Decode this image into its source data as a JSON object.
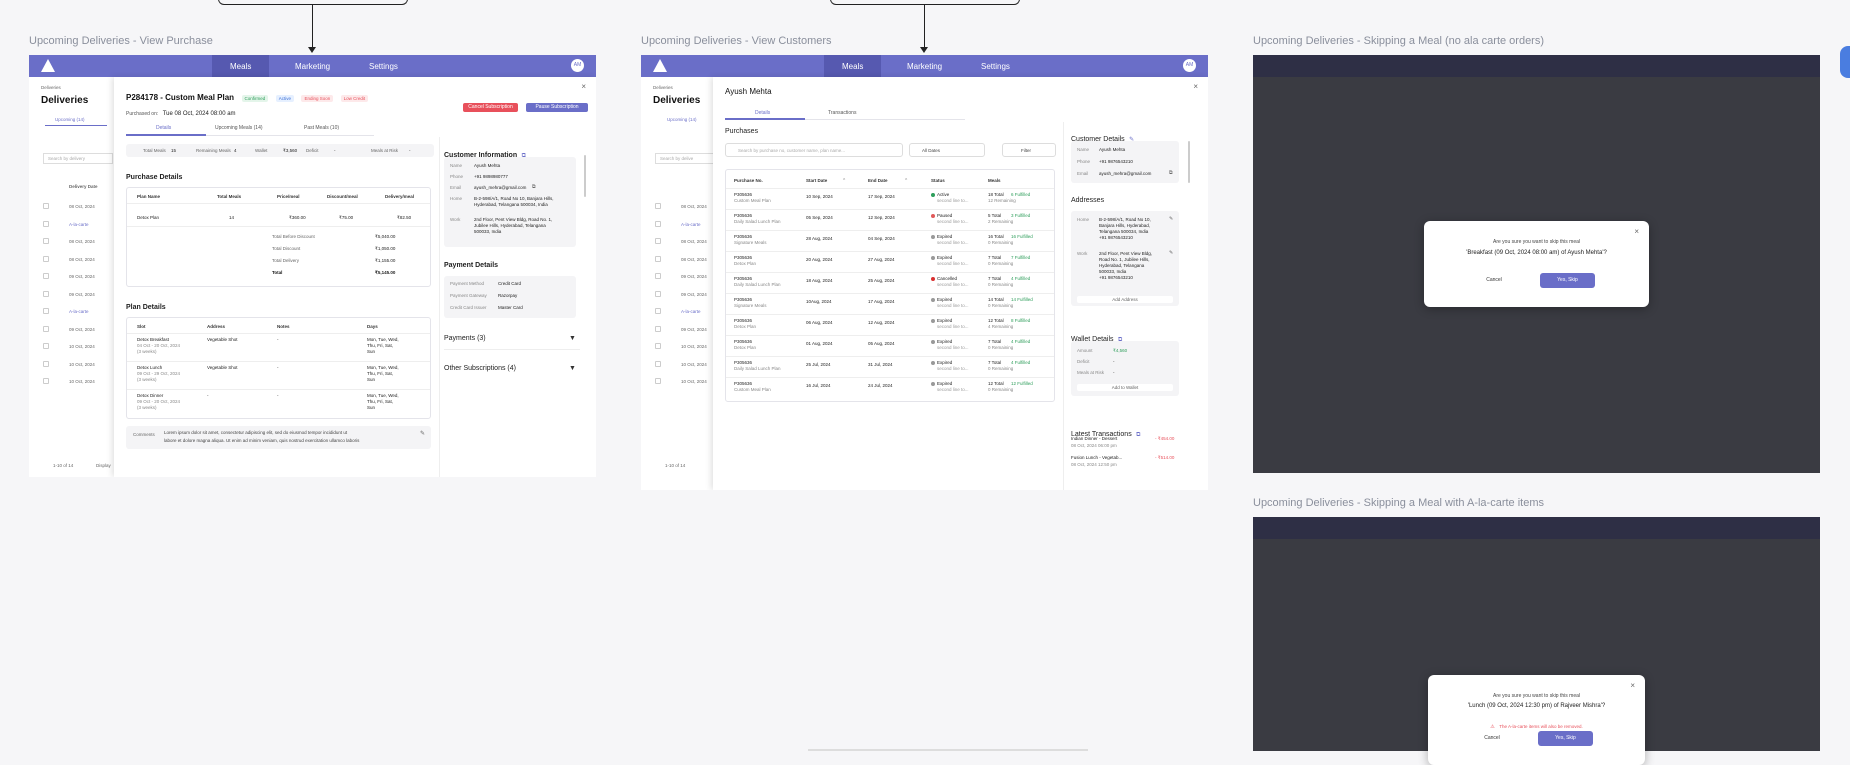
{
  "frames": {
    "purchase": "Upcoming Deliveries - View Purchase",
    "customers": "Upcoming Deliveries - View Customers",
    "skip_no_alacarte": "Upcoming Deliveries - Skipping a Meal (no ala carte orders)",
    "skip_alacarte": "Upcoming Deliveries - Skipping a Meal with A-la-carte items"
  },
  "nav": {
    "meals": "Meals",
    "marketing": "Marketing",
    "settings": "Settings",
    "avatar": "AM"
  },
  "bg": {
    "breadcrumb": "Deliveries",
    "title": "Deliveries",
    "upcoming_tab": "Upcoming (14)",
    "search": "Search by delivery",
    "search2": "Search by delive",
    "date_col": "Delivery Date",
    "dates": [
      "08 Oct, 2024",
      "A-la-carte",
      "08 Oct, 2024",
      "08 Oct, 2024",
      "09 Oct, 2024",
      "09 Oct, 2024",
      "A-la-carte",
      "09 Oct, 2024",
      "10 Oct, 2024",
      "10 Oct, 2024",
      "10 Oct, 2024"
    ],
    "pager": "1-10 of 14",
    "display": "Display"
  },
  "purchase": {
    "title": "P284178 - Custom Meal Plan",
    "badges": [
      "Confirmed",
      "Active",
      "Ending Soon",
      "Low Credit"
    ],
    "purchased_on_label": "Purchased on:",
    "purchased_on": "Tue 08 Oct, 2024 08:00 am",
    "cancel_btn": "Cancel Subscription",
    "pause_btn": "Pause Subscription",
    "tabs": [
      "Details",
      "Upcoming Meals (14)",
      "Past Meals (10)"
    ],
    "stats": [
      {
        "label": "Total Meals",
        "value": "15"
      },
      {
        "label": "Remaining Meals",
        "value": "4"
      },
      {
        "label": "Wallet",
        "value": "₹3,560"
      },
      {
        "label": "Deficit",
        "value": "-"
      },
      {
        "label": "Meals at Risk",
        "value": "-"
      }
    ],
    "purchase_details": "Purchase Details",
    "pd_cols": [
      "Plan Name",
      "Total Meals",
      "Price/meal",
      "Discount/meal",
      "Delivery/meal"
    ],
    "pd_row": [
      "Detox Plan",
      "14",
      "₹360.00",
      "₹75.00",
      "₹82.50"
    ],
    "totals": [
      {
        "label": "Total Before Discount",
        "value": "₹5,040.00"
      },
      {
        "label": "Total Discount",
        "value": "₹1,050.00"
      },
      {
        "label": "Total Delivery",
        "value": "₹1,155.00"
      },
      {
        "label": "Total",
        "value": "₹5,145.00"
      }
    ],
    "plan_details": "Plan Details",
    "plan_cols": [
      "Slot",
      "Address",
      "Notes",
      "Days"
    ],
    "plan_rows": [
      {
        "slot": "Detox Breakfast",
        "sub": "04 Oct - 20 Oct, 2024",
        "sub2": "(3 weeks)",
        "addr": "Vegetable Shot",
        "notes": "-",
        "days": "Mon, Tue, Wed,",
        "days2": "Thu, Fri, Sat,",
        "days3": "Sun"
      },
      {
        "slot": "Detox Lunch",
        "sub": "09 Oct - 29 Oct, 2024",
        "sub2": "(3 weeks)",
        "addr": "Vegetable Shot",
        "notes": "-",
        "days": "Mon, Tue, Wed,",
        "days2": "Thu, Fri, Sat,",
        "days3": "Sun"
      },
      {
        "slot": "Detox Dinner",
        "sub": "09 Oct - 20 Oct, 2024",
        "sub2": "(3 weeks)",
        "addr": "-",
        "notes": "-",
        "days": "Mon, Tue, Wed,",
        "days2": "Thu, Fri, Sat,",
        "days3": "Sun"
      }
    ],
    "comments_label": "Comments",
    "comments": "Lorem ipsum dolor sit amet, consectetur adipiscing elit, sed do eiusmod tempor incididunt ut",
    "comments2": "labore et dolore magna aliqua. Ut enim ad minim veniam, quis nostrud exercitation ullamco laboris",
    "customer_info": "Customer Information",
    "cust": [
      {
        "label": "Name",
        "value": "Ayush Mehta"
      },
      {
        "label": "Phone",
        "value": "+91 9898980777"
      },
      {
        "label": "Email",
        "value": "ayush_mehra@gmail.com"
      },
      {
        "label": "Home",
        "value": "B-2-598/A/1, Road No 10, Banjara Hills,",
        "value2": "Hyderabad, Telangana 500034, India"
      },
      {
        "label": "Work",
        "value": "2nd Floor, Pent View Bldg, Road No. 1,",
        "value2": "Jubilee Hills, Hyderabad, Telangana",
        "value3": "500033, India"
      }
    ],
    "payment_details": "Payment Details",
    "payment": [
      {
        "label": "Payment Method",
        "value": "Credit Card"
      },
      {
        "label": "Payment Gateway",
        "value": "Razorpay"
      },
      {
        "label": "Credit Card Issuer",
        "value": "Master Card"
      }
    ],
    "payments": "Payments (3)",
    "other_subs": "Other Subscriptions (4)"
  },
  "customer": {
    "name": "Ayush Mehta",
    "tabs": [
      "Details",
      "Transactions"
    ],
    "purchases": "Purchases",
    "search": "Search by purchase no, customer name, plan name...",
    "all_dates": "All Dates",
    "filter": "Filter",
    "cols": [
      "Purchase No.",
      "Start Date",
      "End Date",
      "Status",
      "Meals"
    ],
    "rows": [
      {
        "no": "P305636",
        "plan": "Custom Meal Plan",
        "start": "10 Sep, 2024",
        "end": "17 Sep, 2024",
        "status": "Active",
        "sc": "#2e9e5b",
        "total": "18 Total",
        "ful": "6 Fulfilled",
        "rem": "12 Remaining"
      },
      {
        "no": "P305636",
        "plan": "Daily Salad Lunch Plan",
        "start": "05 Sep, 2024",
        "end": "12 Sep, 2024",
        "status": "Paused",
        "sc": "#e05a5a",
        "total": "5 Total",
        "ful": "3 Fulfilled",
        "rem": "2 Remaining"
      },
      {
        "no": "P305636",
        "plan": "Signature Meals",
        "start": "28 Aug, 2024",
        "end": "04 Sep, 2024",
        "status": "Expired",
        "sc": "#999999",
        "total": "16 Total",
        "ful": "16 Fulfilled",
        "rem": "0 Remaining"
      },
      {
        "no": "P305636",
        "plan": "Detox Plan",
        "start": "20 Aug, 2024",
        "end": "27 Aug, 2024",
        "status": "Expired",
        "sc": "#999999",
        "total": "7 Total",
        "ful": "7 Fulfilled",
        "rem": "0 Remaining"
      },
      {
        "no": "P305636",
        "plan": "Daily Salad Lunch Plan",
        "start": "18 Aug, 2024",
        "end": "25 Aug, 2024",
        "status": "Cancelled",
        "sc": "#d93030",
        "total": "7 Total",
        "ful": "4 Fulfilled",
        "rem": "0 Remaining"
      },
      {
        "no": "P305636",
        "plan": "Signature Meals",
        "start": "10Aug, 2024",
        "end": "17 Aug, 2024",
        "status": "Expired",
        "sc": "#999999",
        "total": "14 Total",
        "ful": "14 Fulfilled",
        "rem": "0 Remaining"
      },
      {
        "no": "P305636",
        "plan": "Detox Plan",
        "start": "06 Aug, 2024",
        "end": "12 Aug, 2024",
        "status": "Expired",
        "sc": "#999999",
        "total": "12 Total",
        "ful": "8 Fulfilled",
        "rem": "4 Remaining"
      },
      {
        "no": "P305636",
        "plan": "Detox Plan",
        "start": "01 Aug, 2024",
        "end": "05 Aug, 2024",
        "status": "Expired",
        "sc": "#999999",
        "total": "7 Total",
        "ful": "4 Fulfilled",
        "rem": "0 Remaining"
      },
      {
        "no": "P305636",
        "plan": "Daily Salad Lunch Plan",
        "start": "25 Jul, 2024",
        "end": "31 Jul, 2024",
        "status": "Expired",
        "sc": "#999999",
        "total": "7 Total",
        "ful": "4 Fulfilled",
        "rem": "0 Remaining"
      },
      {
        "no": "P305636",
        "plan": "Custom Meal Plan",
        "start": "16 Jul, 2024",
        "end": "24 Jul, 2024",
        "status": "Expired",
        "sc": "#999999",
        "total": "12 Total",
        "ful": "12 Fulfilled",
        "rem": "0 Remaining"
      }
    ],
    "second": "second line to...",
    "customer_details": "Customer Details",
    "cd": [
      {
        "label": "Name",
        "value": "Ayush Mehta"
      },
      {
        "label": "Phone",
        "value": "+91 9876543210"
      },
      {
        "label": "Email",
        "value": "ayush_mehra@gmail.com"
      }
    ],
    "addresses": "Addresses",
    "home_label": "Home",
    "home": [
      "B-2-598/A/1, Road No 10,",
      "Banjara Hills, Hyderabad,",
      "Telangana 500034, India",
      "+91 9876543210"
    ],
    "work_label": "Work",
    "work": [
      "2nd Floor, Pent View Bldg,",
      "Road No. 1, Jubilee Hills,",
      "Hyderabad, Telangana",
      "500033, India",
      "+91 9876543210"
    ],
    "add_address": "Add Address",
    "wallet_details": "Wallet Details",
    "wallet": [
      {
        "label": "Amount",
        "value": "₹4,560"
      },
      {
        "label": "Deficit",
        "value": "-"
      },
      {
        "label": "Meals at Risk",
        "value": "-"
      }
    ],
    "add_wallet": "Add to Wallet",
    "latest_tx": "Latest Transactions",
    "tx": [
      {
        "name": "Indian Dinner - Dessert",
        "date": "08 Oct, 2024 06:00 pm",
        "amt": "- ₹454.00"
      },
      {
        "name": "Fusion Lunch - Vegetab...",
        "date": "08 Oct, 2024 12:50 pm",
        "amt": "- ₹514.00"
      }
    ]
  },
  "skip1": {
    "q": "Are you sure you want to skip this meal",
    "meal": "'Breakfast (09 Oct, 2024 08:00 am) of Ayush Mehta'?",
    "cancel": "Cancel",
    "confirm": "Yes, Skip"
  },
  "skip2": {
    "q": "Are you sure you want to skip this meal",
    "meal": "'Lunch (09 Oct, 2024 12:30 pm) of Rajveer Mishra'?",
    "warn": "The A-la-carte items will also be removed.",
    "cancel": "Cancel",
    "confirm": "Yes, Skip"
  },
  "colors": {
    "primary": "#6a6ec8",
    "danger": "#e8505b",
    "success": "#2e9e5b"
  }
}
